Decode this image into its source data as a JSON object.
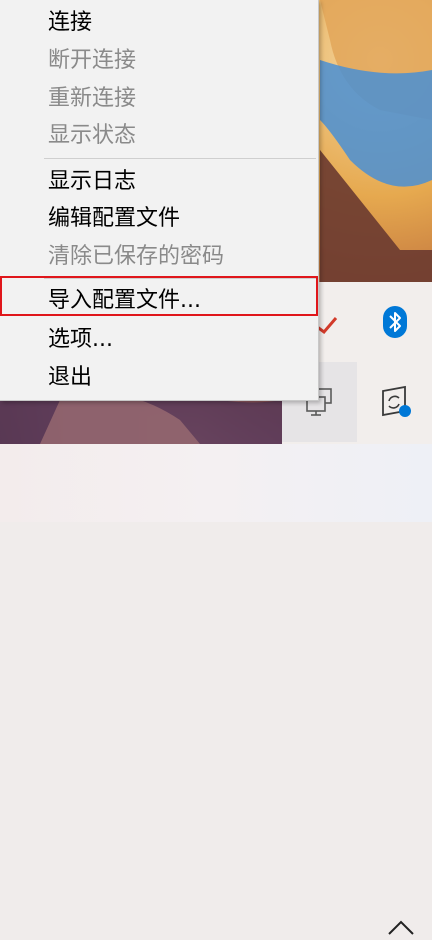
{
  "menu": {
    "items": [
      {
        "label": "连接",
        "enabled": true
      },
      {
        "label": "断开连接",
        "enabled": false
      },
      {
        "label": "重新连接",
        "enabled": false
      },
      {
        "label": "显示状态",
        "enabled": false
      },
      {
        "label": "显示日志",
        "enabled": true
      },
      {
        "label": "编辑配置文件",
        "enabled": true
      },
      {
        "label": "清除已保存的密码",
        "enabled": false
      },
      {
        "label": "导入配置文件...",
        "enabled": true,
        "highlighted": true
      },
      {
        "label": "选项...",
        "enabled": true
      },
      {
        "label": "退出",
        "enabled": true
      }
    ]
  },
  "tray": {
    "icons": [
      "openvpn-icon",
      "bluetooth-icon",
      "network-icon",
      "sync-status-icon"
    ],
    "accent_color": "#0078d7",
    "highlight_color": "#e0161b"
  },
  "taskbar": {
    "expand_icon": "chevron-up-icon"
  }
}
